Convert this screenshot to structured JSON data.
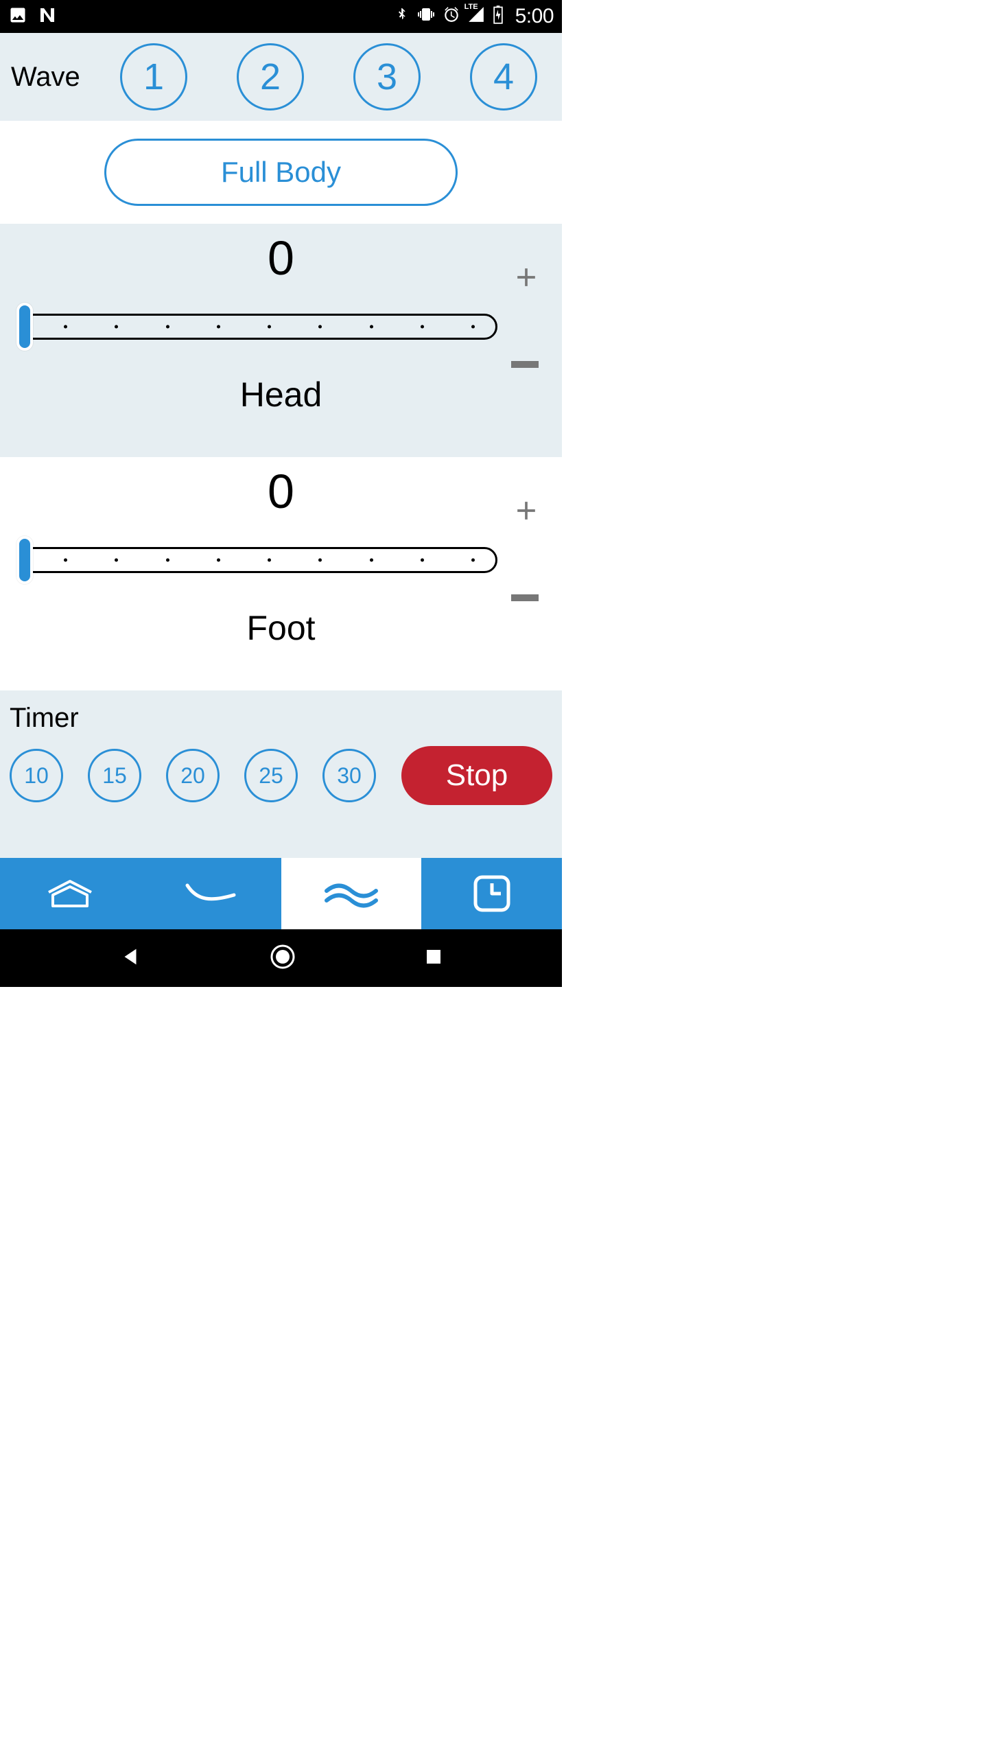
{
  "status": {
    "time": "5:00",
    "lte_label": "LTE"
  },
  "wave": {
    "label": "Wave",
    "options": [
      "1",
      "2",
      "3",
      "4"
    ]
  },
  "full_body": {
    "label": "Full Body"
  },
  "sliders": {
    "head": {
      "value": "0",
      "label": "Head"
    },
    "foot": {
      "value": "0",
      "label": "Foot"
    }
  },
  "timer": {
    "label": "Timer",
    "options": [
      "10",
      "15",
      "20",
      "25",
      "30"
    ],
    "stop_label": "Stop"
  }
}
